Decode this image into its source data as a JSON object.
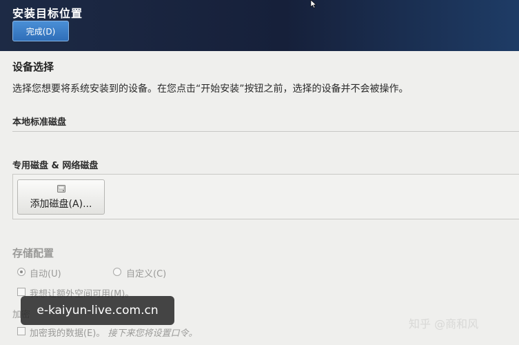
{
  "header": {
    "title": "安装目标位置",
    "done_label": "完成(D)",
    "bg_color": "#16203a",
    "button_color": "#2f6eb8"
  },
  "device_selection": {
    "title": "设备选择",
    "description": "选择您想要将系统安装到的设备。在您点击“开始安装”按钮之前，选择的设备并不会被操作。"
  },
  "local_disks": {
    "title": "本地标准磁盘"
  },
  "specialized_disks": {
    "title": "专用磁盘 & 网络磁盘",
    "add_disk_label": "添加磁盘(A)...",
    "add_disk_icon": "disk-icon"
  },
  "storage_config": {
    "title": "存储配置",
    "auto_label": "自动(U)",
    "custom_label": "自定义(C)",
    "selected": "auto",
    "extra_space_label": "我想让额外空间可用(M)。"
  },
  "encryption": {
    "title_partial": "加密",
    "encrypt_label": "加密我的数据(E)。",
    "encrypt_note": "接下来您将设置口令。"
  },
  "overlay": {
    "watermark": "e-kaiyun-live.com.cn",
    "source_mark": "知乎 @商和风"
  }
}
